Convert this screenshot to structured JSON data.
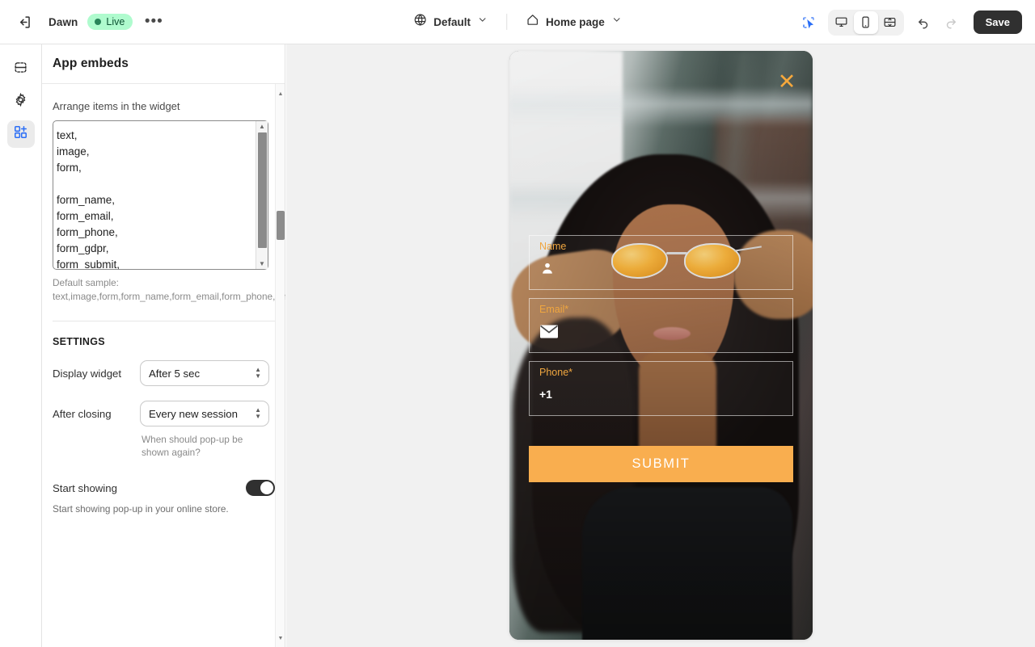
{
  "topbar": {
    "exit_icon": "exit-icon",
    "theme_name": "Dawn",
    "status_badge": "Live",
    "more_label": "•••",
    "locale_icon": "globe-icon",
    "locale_label": "Default",
    "page_icon": "home-icon",
    "page_label": "Home page",
    "select_icon": "pointer-select-icon",
    "device_desktop": "desktop-icon",
    "device_mobile": "mobile-icon",
    "device_fullscreen": "fullscreen-icon",
    "undo_icon": "undo-icon",
    "redo_icon": "redo-icon",
    "save_label": "Save",
    "active_device": "mobile"
  },
  "rail": {
    "items": [
      {
        "name": "sections",
        "icon": "sections-icon",
        "active": false
      },
      {
        "name": "settings",
        "icon": "gear-icon",
        "active": false
      },
      {
        "name": "app-embeds",
        "icon": "apps-blocks-icon",
        "active": true
      }
    ]
  },
  "panel": {
    "title": "App embeds",
    "arrange_label": "Arrange items in the widget",
    "arrange_value": "text,\nimage,\nform,\n\nform_name,\nform_email,\nform_phone,\nform_gdpr,\nform_submit,",
    "default_sample_label": "Default sample:",
    "default_sample_value": "text,image,form,form_name,form_email,form_phone,form_gdpr,form_submit,",
    "settings_title": "SETTINGS",
    "display_widget_label": "Display widget",
    "display_widget_value": "After 5 sec",
    "after_closing_label": "After closing",
    "after_closing_value": "Every new session",
    "after_closing_helper": "When should pop-up be shown again?",
    "start_showing_label": "Start showing",
    "start_showing_helper": "Start showing pop-up in your online store.",
    "start_showing_enabled": true
  },
  "preview": {
    "close_icon": "close-x-icon",
    "close_color": "#f0a63f",
    "accent_color": "#f9ae4f",
    "fields": [
      {
        "label": "Name",
        "icon": "person-icon",
        "icon_glyph": "■"
      },
      {
        "label": "Email*",
        "icon": "envelope-icon",
        "icon_glyph": "✉"
      },
      {
        "label": "Phone*",
        "icon": "phone-prefix",
        "icon_glyph": "+1"
      }
    ],
    "submit_label": "SUBMIT"
  }
}
